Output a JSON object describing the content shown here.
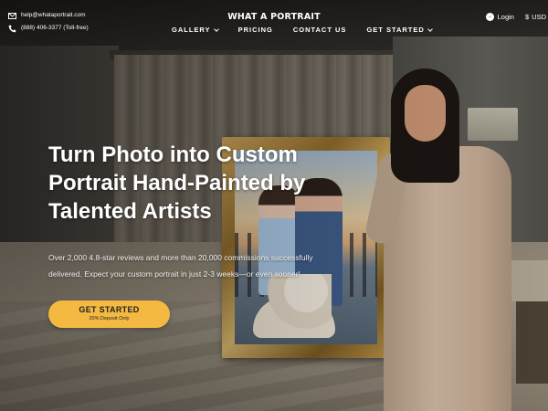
{
  "header": {
    "email": "help@whataportrait.com",
    "phone": "(888) 406-3377 (Toll-free)",
    "logo": "WHAT A PORTRAIT",
    "nav": [
      {
        "label": "GALLERY",
        "has_dropdown": true
      },
      {
        "label": "PRICING",
        "has_dropdown": false
      },
      {
        "label": "CONTACT US",
        "has_dropdown": false
      },
      {
        "label": "GET STARTED",
        "has_dropdown": true
      }
    ],
    "login_label": "Login",
    "currency_symbol": "$",
    "currency_label": "USD"
  },
  "hero": {
    "title_lines": [
      "Turn Photo into Custom",
      "Portrait Hand-Painted by",
      "Talented Artists"
    ],
    "subtitle_lines": [
      "Over 2,000 4.8-star reviews and more than 20,000 commissions successfully",
      "delivered. Expect your custom portrait in just 2-3 weeks—or even sooner!"
    ],
    "cta_label": "GET STARTED",
    "cta_sublabel": "20% Deposit Only"
  },
  "colors": {
    "cta_background": "#f4b940",
    "text": "#ffffff"
  },
  "icons": {
    "email": "mail-icon",
    "phone": "phone-icon",
    "login": "login-icon",
    "dropdown": "chevron-down-icon"
  }
}
